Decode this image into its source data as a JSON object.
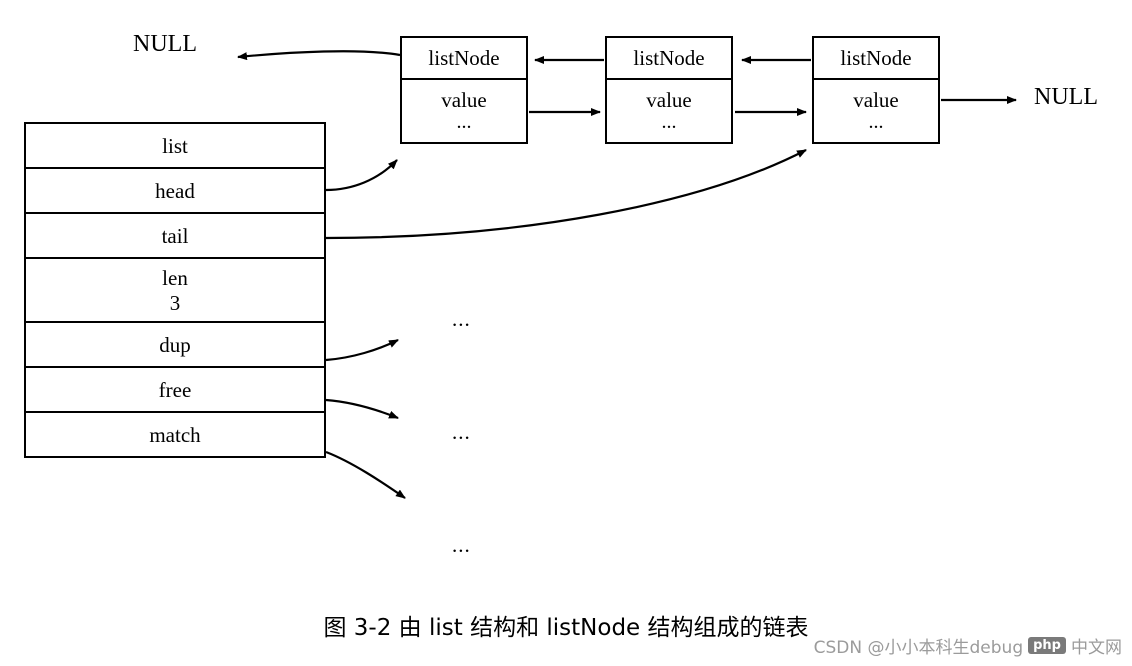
{
  "diagram": {
    "list_struct": {
      "name": "list-struct",
      "rows": [
        {
          "label": "list",
          "sub": ""
        },
        {
          "label": "head",
          "sub": ""
        },
        {
          "label": "tail",
          "sub": ""
        },
        {
          "label": "len",
          "sub": "3"
        },
        {
          "label": "dup",
          "sub": ""
        },
        {
          "label": "free",
          "sub": ""
        },
        {
          "label": "match",
          "sub": ""
        }
      ]
    },
    "nodes": [
      {
        "title": "listNode",
        "value": "value",
        "dots": "..."
      },
      {
        "title": "listNode",
        "value": "value",
        "dots": "..."
      },
      {
        "title": "listNode",
        "value": "value",
        "dots": "..."
      }
    ],
    "labels": {
      "null_left": "NULL",
      "null_right": "NULL",
      "ellipsis_a": "...",
      "ellipsis_b": "...",
      "ellipsis_c": "..."
    },
    "caption": "图 3-2   由 list 结构和 listNode 结构组成的链表",
    "watermark": {
      "text_left": "CSDN @小小本科生debug",
      "badge": "php",
      "text_right": "中文网"
    }
  }
}
